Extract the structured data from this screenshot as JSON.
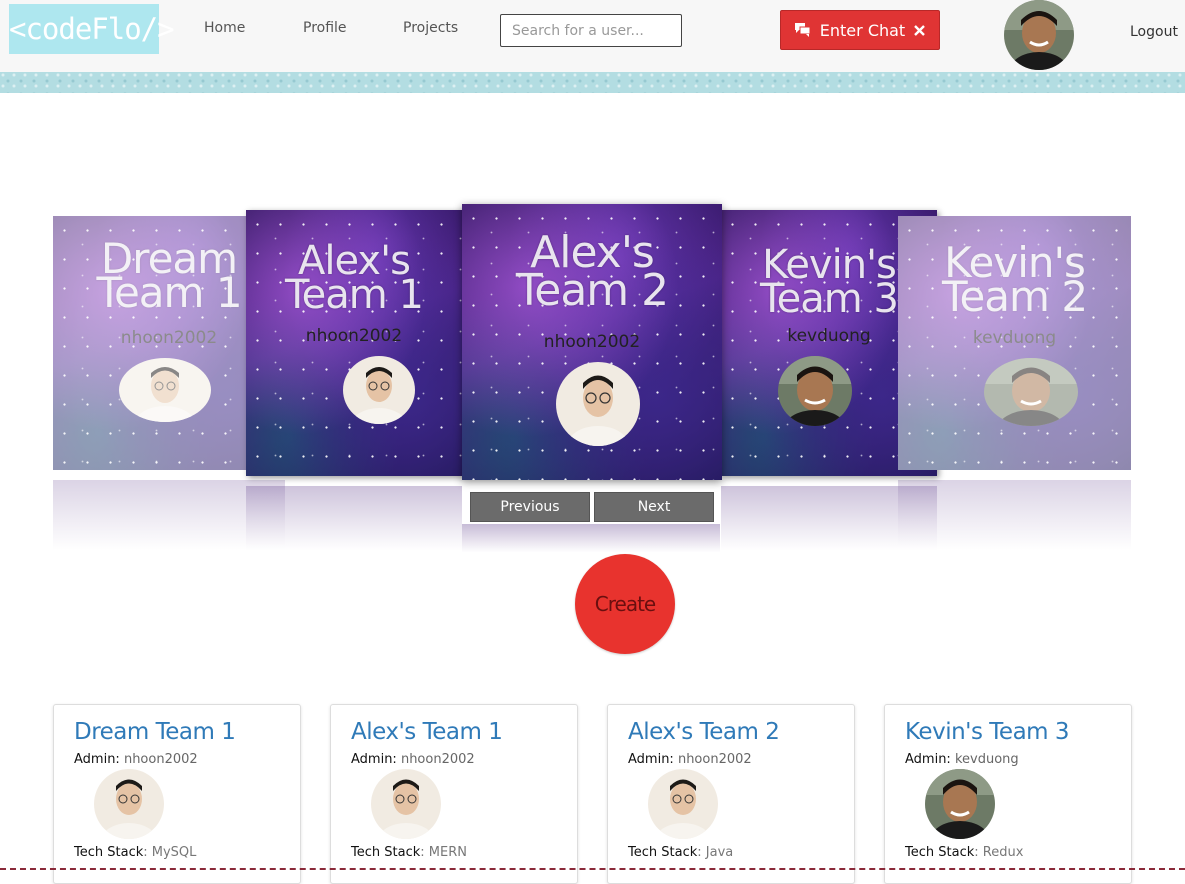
{
  "header": {
    "logo_text": "<codeFlo/>",
    "nav": [
      {
        "label": "Home"
      },
      {
        "label": "Profile"
      },
      {
        "label": "Projects"
      }
    ],
    "search_placeholder": "Search for a user...",
    "chat_button_label": "Enter Chat",
    "logout_label": "Logout"
  },
  "carousel": {
    "slides": [
      {
        "title_line1": "Dream",
        "title_line2": "Team 1",
        "owner": "nhoon2002"
      },
      {
        "title_line1": "Alex's",
        "title_line2": "Team 1",
        "owner": "nhoon2002"
      },
      {
        "title_line1": "Alex's",
        "title_line2": "Team 2",
        "owner": "nhoon2002"
      },
      {
        "title_line1": "Kevin's",
        "title_line2": "Team 3",
        "owner": "kevduong"
      },
      {
        "title_line1": "Kevin's",
        "title_line2": "Team 2",
        "owner": "kevduong"
      }
    ],
    "prev_label": "Previous",
    "next_label": "Next"
  },
  "create_label": "Create",
  "cards": [
    {
      "title": "Dream Team 1",
      "admin_label": "Admin:",
      "admin": "nhoon2002",
      "stack_label": "Tech Stack",
      "stack": "MySQL"
    },
    {
      "title": "Alex's Team 1",
      "admin_label": "Admin:",
      "admin": "nhoon2002",
      "stack_label": "Tech Stack",
      "stack": "MERN"
    },
    {
      "title": "Alex's Team 2",
      "admin_label": "Admin:",
      "admin": "nhoon2002",
      "stack_label": "Tech Stack",
      "stack": "Java"
    },
    {
      "title": "Kevin's Team 3",
      "admin_label": "Admin:",
      "admin": "kevduong",
      "stack_label": "Tech Stack",
      "stack": "Redux"
    }
  ],
  "colors": {
    "accent_red": "#e03434",
    "card_title_blue": "#2f7ab8",
    "logo_bg": "#aee7ef"
  }
}
